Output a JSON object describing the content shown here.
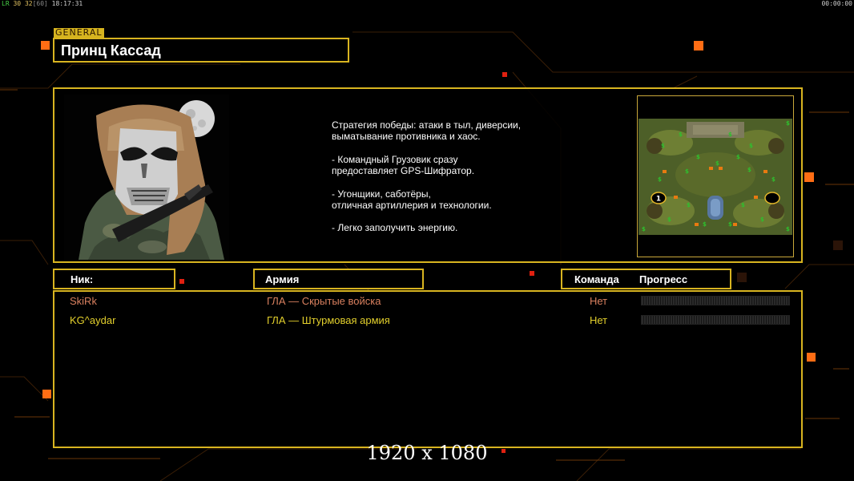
{
  "hud": {
    "tl_a": "LR",
    "tl_b": "30",
    "tl_c": "32",
    "tl_d": "[60]",
    "tl_time": "18:17:31",
    "tr_time": "00:00:00"
  },
  "general": {
    "rank_tag": "GENERAL",
    "name": "Принц Кассад"
  },
  "description": [
    "Стратегия победы: атаки в тыл, диверсии,",
    " выматывание противника и хаос.",
    "",
    "- Командный Грузовик сразу",
    "предоставляет GPS-Шифратор.",
    "",
    "- Угонщики, саботёры,",
    "отличная артиллерия и технологии.",
    "",
    "- Легко заполучить энергию."
  ],
  "map": {
    "start_position_label": "1"
  },
  "columns": {
    "nick": "Ник:",
    "army": "Армия",
    "team": "Команда",
    "progress": "Прогресс"
  },
  "players": [
    {
      "nick": "SkiRk",
      "army": "ГЛА — Скрытые войска",
      "team": "Нет",
      "color": "#d9805f",
      "progress": 0
    },
    {
      "nick": "KG^aydar",
      "army": "ГЛА — Штурмовая армия",
      "team": "Нет",
      "color": "#e2cf2c",
      "progress": 0
    }
  ],
  "overlay": {
    "resolution": "1920 x 1080"
  },
  "colors": {
    "frame": "#d8b420",
    "accent_orange": "#ff7a1a"
  }
}
